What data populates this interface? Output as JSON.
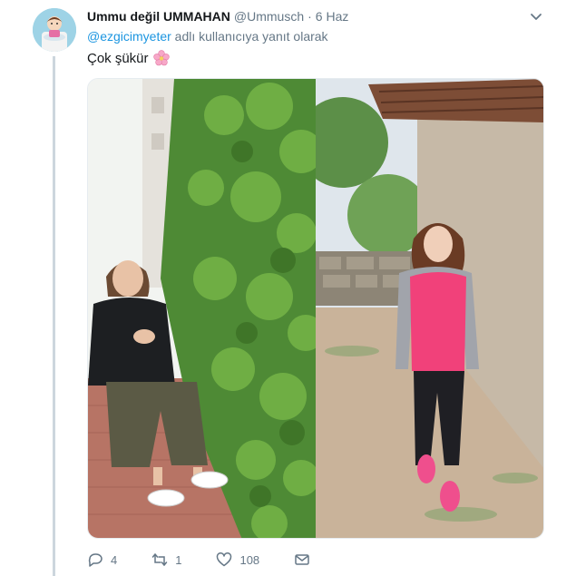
{
  "tweet": {
    "display_name": "Ummu değil UMMAHAN",
    "handle": "@Ummusch",
    "separator": "·",
    "date": "6 Haz",
    "reply_mention": "@ezgicimyeter",
    "reply_suffix": " adlı kullanıcıya yanıt olarak",
    "text": "Çok şükür"
  },
  "actions": {
    "reply_count": "4",
    "retweet_count": "1",
    "like_count": "108"
  },
  "icons": {
    "avatar": "cartoon-avatar",
    "caret": "chevron-down-icon",
    "emoji": "blossom-emoji",
    "reply": "reply-icon",
    "retweet": "retweet-icon",
    "like": "heart-icon",
    "dm": "envelope-icon"
  },
  "colors": {
    "link": "#1b95e0",
    "muted": "#657786",
    "thread_line": "#ccd6dd"
  }
}
